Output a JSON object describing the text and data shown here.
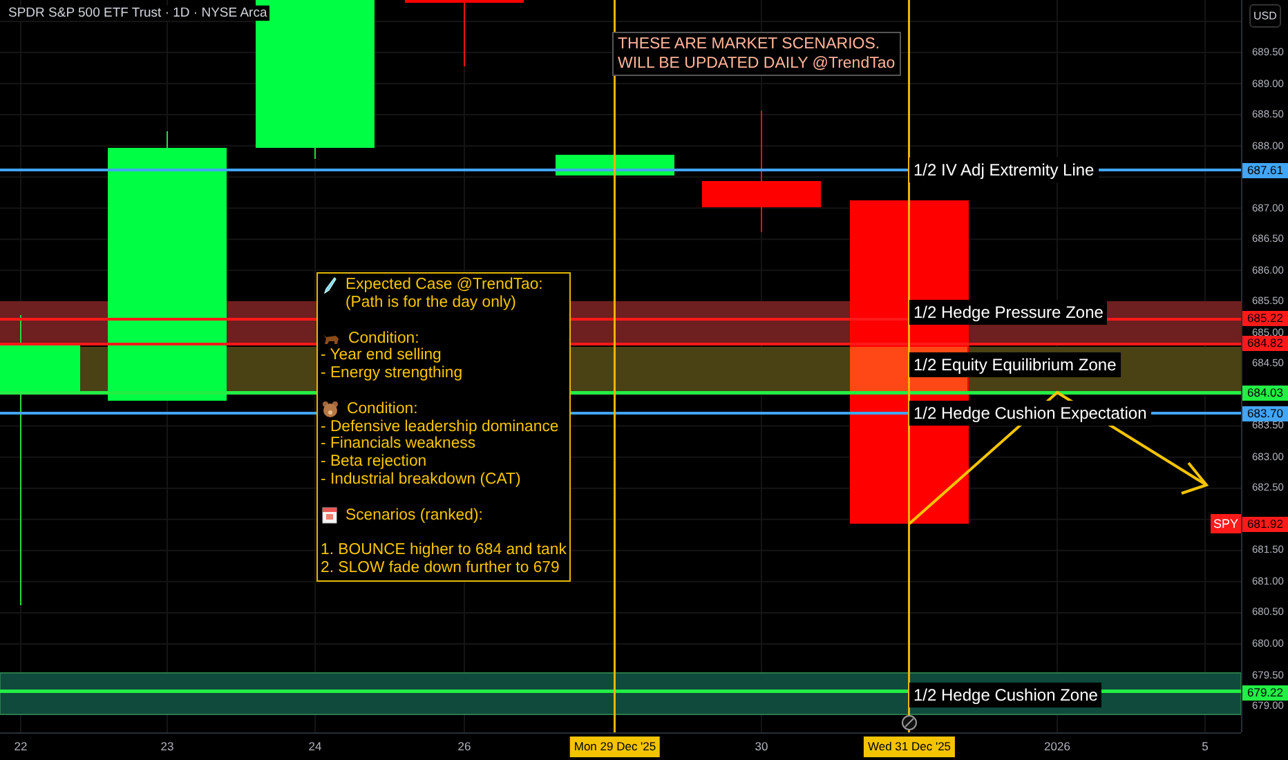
{
  "chart": {
    "title": "SPDR S&P 500 ETF Trust · 1D · NYSE Arca",
    "currency_button": "USD",
    "note": [
      "THESE ARE MARKET SCENARIOS.",
      "WILL BE UPDATED DAILY @TrendTao"
    ],
    "scenario_box": {
      "sections": [
        {
          "heading": "Expected Case @TrendTao:",
          "lines": [
            "(Path is for the day only)"
          ]
        },
        {
          "heading": "Condition:",
          "lines": [
            "- Year end selling",
            "- Energy strengthing"
          ]
        },
        {
          "heading": "Condition:",
          "lines": [
            "- Defensive leadership dominance",
            "- Financials weakness",
            "- Beta rejection",
            "- Industrial breakdown (CAT)"
          ]
        },
        {
          "heading": "Scenarios (ranked):"
        }
      ],
      "ranked": [
        "1. BOUNCE higher to 684 and tank",
        "2. SLOW fade down further to 679"
      ]
    },
    "level_labels": [
      "1/2 IV Adj Extremity Line",
      "1/2 Hedge Pressure Zone",
      "1/2 Equity Equilibrium Zone",
      "1/2 Hedge Cushion Expectation",
      "1/2 Hedge Cushion Zone"
    ],
    "price_axis": {
      "ticks": [
        "689.50",
        "689.00",
        "688.50",
        "688.00",
        "687.00",
        "686.50",
        "686.00",
        "685.50",
        "685.00",
        "684.50",
        "683.50",
        "683.00",
        "682.50",
        "681.50",
        "681.00",
        "680.50",
        "680.00",
        "679.50",
        "679.00"
      ],
      "badges": [
        {
          "text": "687.61",
          "color": "#42a5f5"
        },
        {
          "text": "685.22",
          "color": "#ff1a1a"
        },
        {
          "text": "684.82",
          "color": "#ff1a1a"
        },
        {
          "text": "684.03",
          "color": "#22ee44"
        },
        {
          "text": "683.70",
          "color": "#42a5f5"
        },
        {
          "text": "681.92",
          "color": "#ff1a1a"
        },
        {
          "text": "679.22",
          "color": "#22ee44"
        }
      ],
      "symbol_tag": "SPY"
    },
    "time_axis": [
      {
        "label": "22",
        "selected": false
      },
      {
        "label": "23",
        "selected": false
      },
      {
        "label": "24",
        "selected": false
      },
      {
        "label": "26",
        "selected": false
      },
      {
        "label": "Mon 29 Dec '25",
        "selected": true
      },
      {
        "label": "30",
        "selected": false
      },
      {
        "label": "Wed 31 Dec '25",
        "selected": true
      },
      {
        "label": "2026",
        "selected": false
      },
      {
        "label": "5",
        "selected": false
      }
    ]
  }
}
